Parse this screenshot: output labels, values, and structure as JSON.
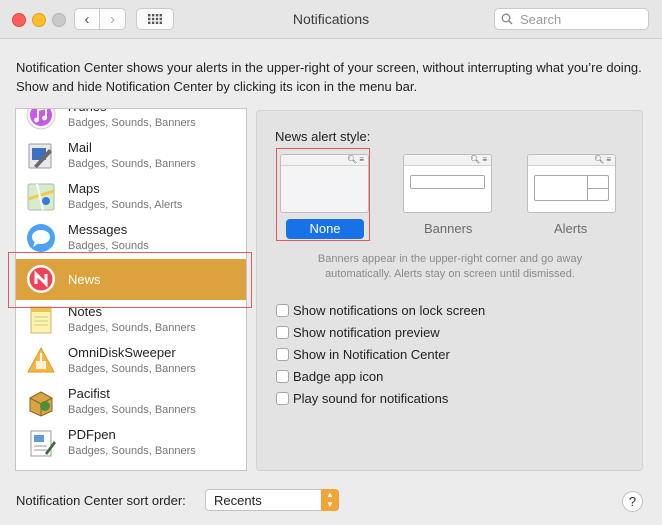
{
  "window": {
    "title": "Notifications",
    "search_placeholder": "Search"
  },
  "description": "Notification Center shows your alerts in the upper-right of your screen, without interrupting what you’re doing. Show and hide Notification Center by clicking its icon in the menu bar.",
  "apps": [
    {
      "name": "iTunes",
      "subtitle": "Badges, Sounds, Banners",
      "icon": "itunes-icon"
    },
    {
      "name": "Mail",
      "subtitle": "Badges, Sounds, Banners",
      "icon": "mail-icon"
    },
    {
      "name": "Maps",
      "subtitle": "Badges, Sounds, Alerts",
      "icon": "maps-icon"
    },
    {
      "name": "Messages",
      "subtitle": "Badges, Sounds",
      "icon": "messages-icon"
    },
    {
      "name": "News",
      "subtitle": "",
      "icon": "news-icon",
      "selected": true
    },
    {
      "name": "Notes",
      "subtitle": "Badges, Sounds, Banners",
      "icon": "notes-icon"
    },
    {
      "name": "OmniDiskSweeper",
      "subtitle": "Badges, Sounds, Banners",
      "icon": "omnidisksweeper-icon"
    },
    {
      "name": "Pacifist",
      "subtitle": "Badges, Sounds, Banners",
      "icon": "pacifist-icon"
    },
    {
      "name": "PDFpen",
      "subtitle": "Badges, Sounds, Banners",
      "icon": "pdfpen-icon"
    }
  ],
  "detail": {
    "style_label": "News alert style:",
    "styles": {
      "none": "None",
      "banners": "Banners",
      "alerts": "Alerts"
    },
    "selected_style": "None",
    "helper": "Banners appear in the upper-right corner and go away automatically. Alerts stay on screen until dismissed.",
    "options": [
      {
        "label": "Show notifications on lock screen",
        "checked": false
      },
      {
        "label": "Show notification preview",
        "checked": false
      },
      {
        "label": "Show in Notification Center",
        "checked": false
      },
      {
        "label": "Badge app icon",
        "checked": false
      },
      {
        "label": "Play sound for notifications",
        "checked": false
      }
    ]
  },
  "footer": {
    "sort_label": "Notification Center sort order:",
    "sort_value": "Recents",
    "help": "?"
  },
  "colors": {
    "selection": "#dba23d",
    "accent": "#1772e8",
    "highlight_box": "#e85a5a"
  }
}
